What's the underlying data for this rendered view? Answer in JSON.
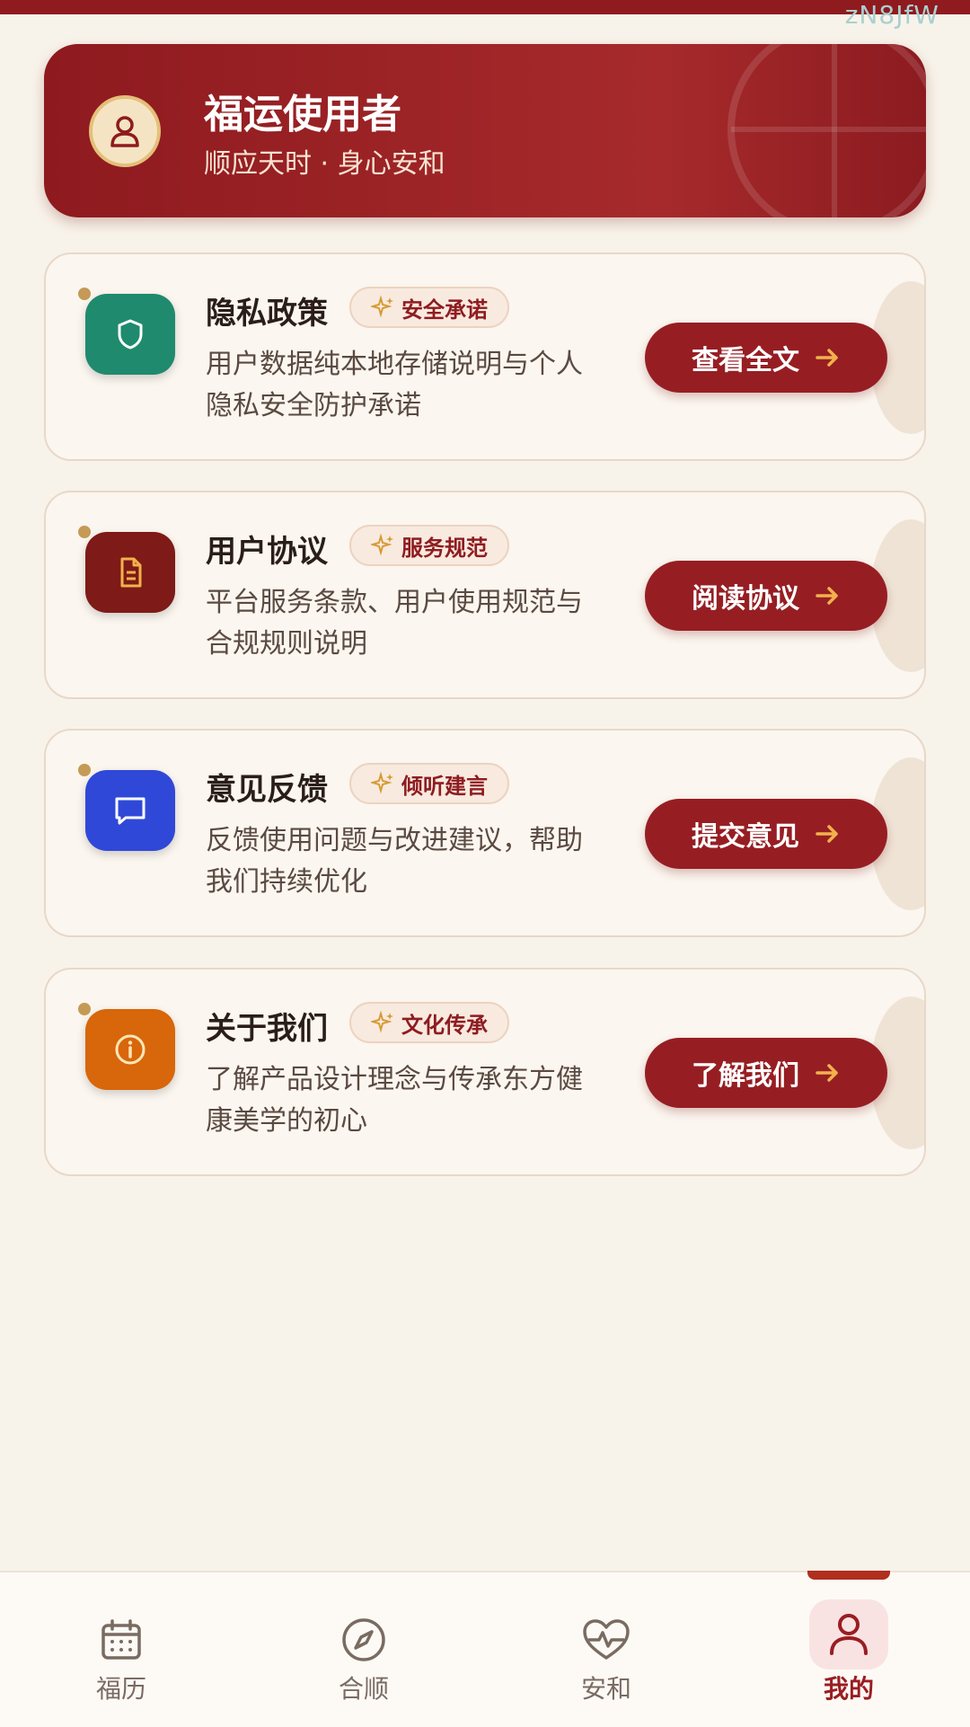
{
  "watermark": "zN8JfW",
  "profile": {
    "name": "福运使用者",
    "subtitle": "顺应天时 · 身心安和"
  },
  "cards": [
    {
      "title": "隐私政策",
      "tag": "安全承诺",
      "desc": "用户数据纯本地存储说明与个人隐私安全防护承诺",
      "button": "查看全文",
      "icon": "shield-icon",
      "color": "#1f8a6e"
    },
    {
      "title": "用户协议",
      "tag": "服务规范",
      "desc": "平台服务条款、用户使用规范与合规规则说明",
      "button": "阅读协议",
      "icon": "document-icon",
      "color": "#7e1a17"
    },
    {
      "title": "意见反馈",
      "tag": "倾听建言",
      "desc": "反馈使用问题与改进建议，帮助我们持续优化",
      "button": "提交意见",
      "icon": "chat-icon",
      "color": "#3048d8"
    },
    {
      "title": "关于我们",
      "tag": "文化传承",
      "desc": "了解产品设计理念与传承东方健康美学的初心",
      "button": "了解我们",
      "icon": "info-icon",
      "color": "#d8660a"
    }
  ],
  "tabs": [
    {
      "label": "福历",
      "icon": "calendar-icon"
    },
    {
      "label": "合顺",
      "icon": "compass-icon"
    },
    {
      "label": "安和",
      "icon": "heart-pulse-icon"
    },
    {
      "label": "我的",
      "icon": "user-icon",
      "active": true
    }
  ],
  "colors": {
    "primary": "#961e23",
    "accent": "#e9b04a",
    "background": "#f8f3ea"
  }
}
